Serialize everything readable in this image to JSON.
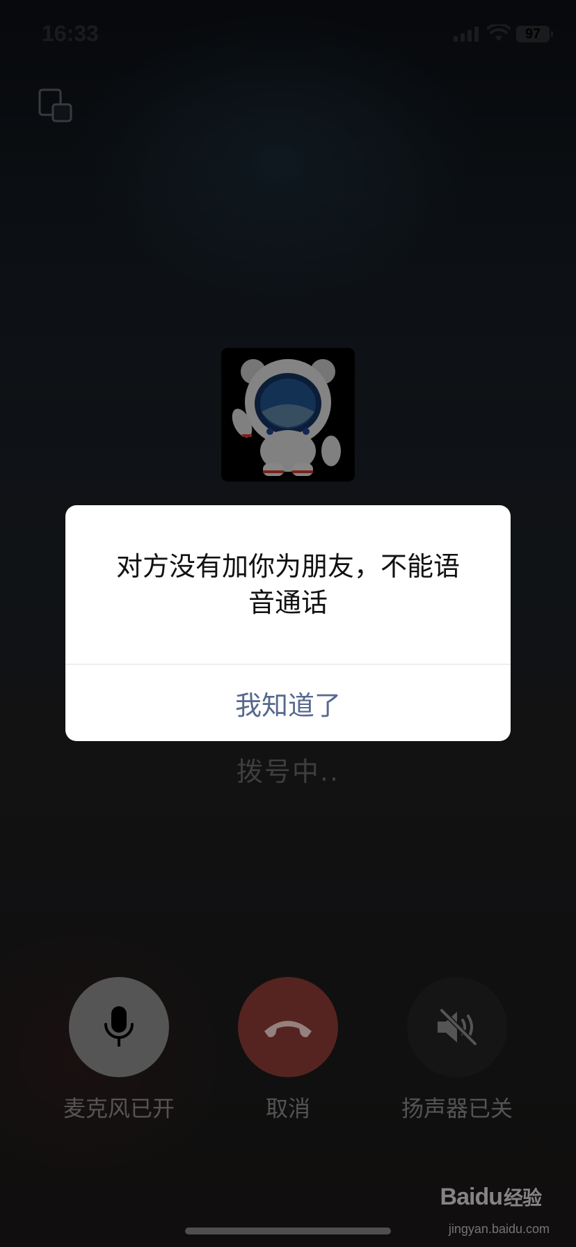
{
  "status_bar": {
    "time": "16:33",
    "battery": "97",
    "icons": [
      "signal-icon",
      "wifi-icon"
    ]
  },
  "header": {
    "float_window_icon": "float-window-icon"
  },
  "call": {
    "avatar_icon": "astronaut-avatar",
    "status": "拨号中.."
  },
  "controls": [
    {
      "label": "麦克风已开",
      "icon": "microphone-icon"
    },
    {
      "label": "取消",
      "icon": "hang-up-icon"
    },
    {
      "label": "扬声器已关",
      "icon": "speaker-muted-icon"
    }
  ],
  "alert": {
    "message_line1": "对方没有加你为朋友，不能语",
    "message_line2": "音通话",
    "button": "我知道了"
  },
  "watermark": {
    "logo_text": "Bai",
    "logo_text2": "du",
    "logo_cn": "经验",
    "url": "jingyan.baidu.com"
  },
  "colors": {
    "alert_button": "#56698f",
    "cancel_button": "#8a3a36",
    "mic_button": "#8a8a8a",
    "speaker_button": "#232323"
  }
}
